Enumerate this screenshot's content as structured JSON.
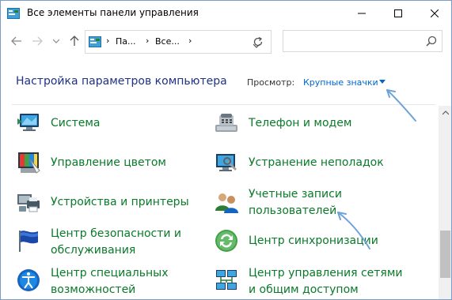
{
  "window": {
    "title": "Все элементы панели управления"
  },
  "address": {
    "crumbs": [
      "Па...",
      "Все..."
    ]
  },
  "search": {
    "placeholder": ""
  },
  "header": {
    "title": "Настройка параметров компьютера",
    "view_label": "Просмотр:",
    "view_value": "Крупные значки"
  },
  "items": [
    {
      "label1": "Система",
      "label2": "",
      "icon": "system-icon"
    },
    {
      "label1": "Телефон и модем",
      "label2": "",
      "icon": "phone-modem-icon"
    },
    {
      "label1": "Управление цветом",
      "label2": "",
      "icon": "color-management-icon"
    },
    {
      "label1": "Устранение неполадок",
      "label2": "",
      "icon": "troubleshooting-icon"
    },
    {
      "label1": "Устройства и принтеры",
      "label2": "",
      "icon": "devices-printers-icon"
    },
    {
      "label1": "Учетные записи",
      "label2": "пользователей",
      "icon": "user-accounts-icon"
    },
    {
      "label1": "Центр безопасности и",
      "label2": "обслуживания",
      "icon": "security-maintenance-icon"
    },
    {
      "label1": "Центр синхронизации",
      "label2": "",
      "icon": "sync-center-icon"
    },
    {
      "label1": "Центр специальных",
      "label2": "возможностей",
      "icon": "ease-of-access-icon"
    },
    {
      "label1": "Центр управления сетями",
      "label2": "и общим доступом",
      "icon": "network-sharing-icon"
    }
  ],
  "colors": {
    "link_green": "#0a7a2a",
    "title_blue": "#1e3287",
    "view_blue": "#0066cc",
    "annotation_arrow": "#6fa3d8"
  }
}
